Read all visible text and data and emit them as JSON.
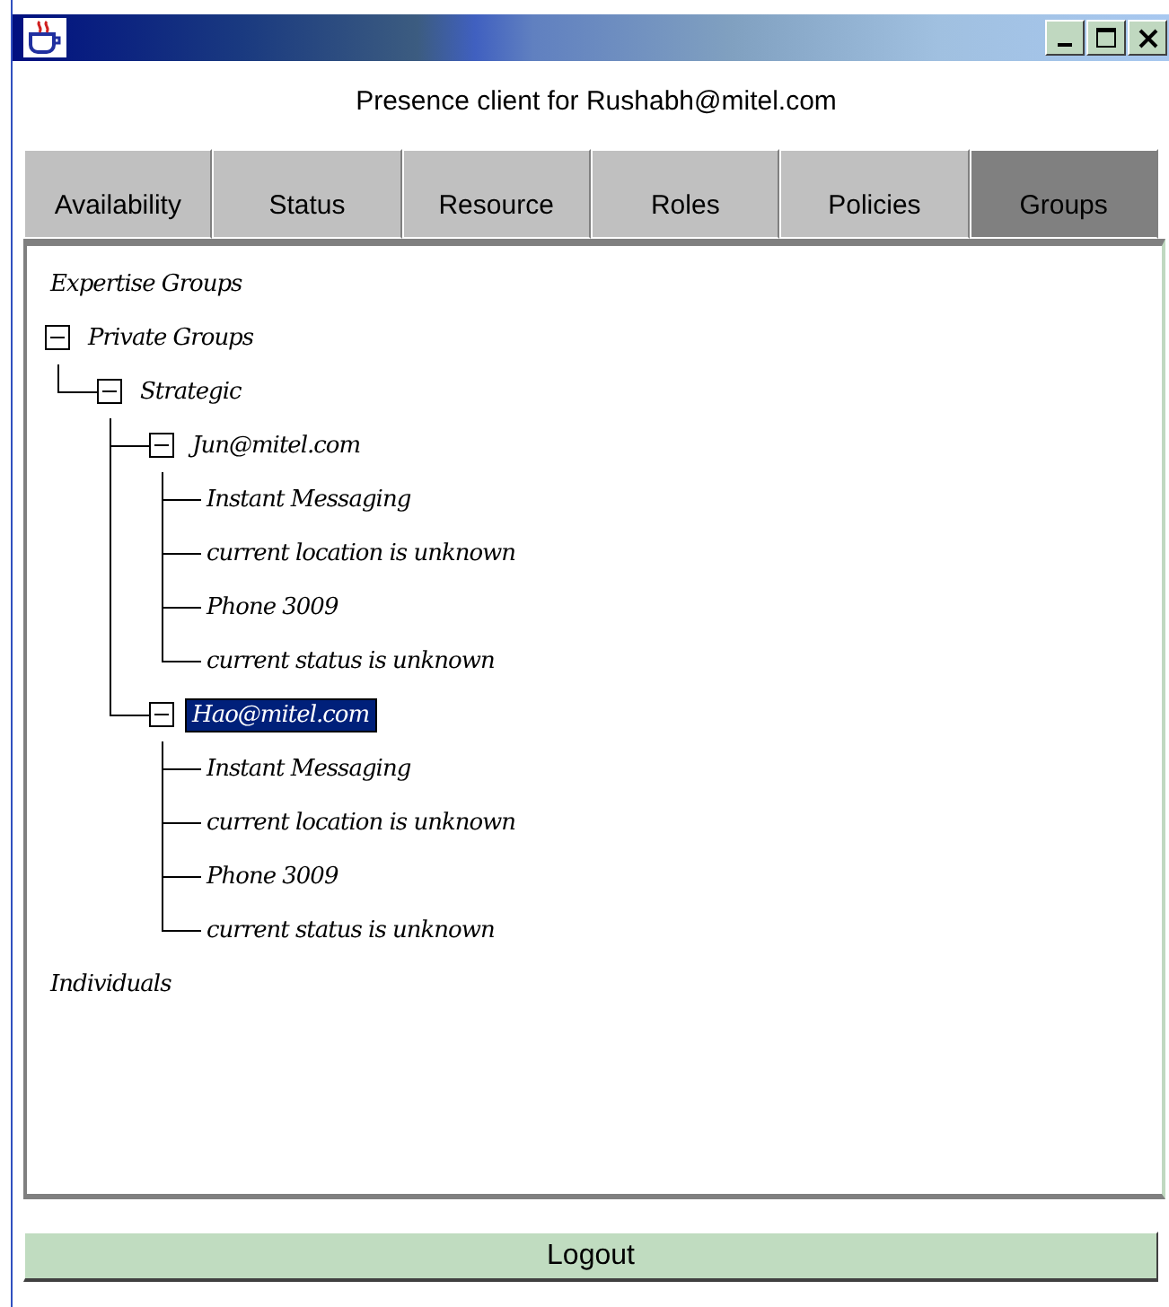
{
  "window": {
    "heading": "Presence client for Rushabh@mitel.com"
  },
  "tabs": [
    {
      "label": "Availability",
      "selected": false
    },
    {
      "label": "Status",
      "selected": false
    },
    {
      "label": "Resource",
      "selected": false
    },
    {
      "label": "Roles",
      "selected": false
    },
    {
      "label": "Policies",
      "selected": false
    },
    {
      "label": "Groups",
      "selected": true
    }
  ],
  "tree": [
    {
      "label": "Expertise Groups",
      "selected": false
    },
    {
      "label": "Private Groups",
      "selected": false,
      "expanded": true,
      "children": [
        {
          "label": "Strategic",
          "selected": false,
          "expanded": true,
          "children": [
            {
              "label": "Jun@mitel.com",
              "selected": false,
              "expanded": true,
              "children": [
                {
                  "label": "Instant Messaging",
                  "selected": false
                },
                {
                  "label": "current location is unknown",
                  "selected": false
                },
                {
                  "label": "Phone 3009",
                  "selected": false
                },
                {
                  "label": "current status is unknown",
                  "selected": false
                }
              ]
            },
            {
              "label": "Hao@mitel.com",
              "selected": true,
              "expanded": true,
              "children": [
                {
                  "label": "Instant Messaging",
                  "selected": false
                },
                {
                  "label": "current location is unknown",
                  "selected": false
                },
                {
                  "label": "Phone 3009",
                  "selected": false
                },
                {
                  "label": "current status is unknown",
                  "selected": false
                }
              ]
            }
          ]
        }
      ]
    },
    {
      "label": "Individuals",
      "selected": false
    }
  ],
  "buttons": [
    {
      "label": "Logout"
    }
  ]
}
